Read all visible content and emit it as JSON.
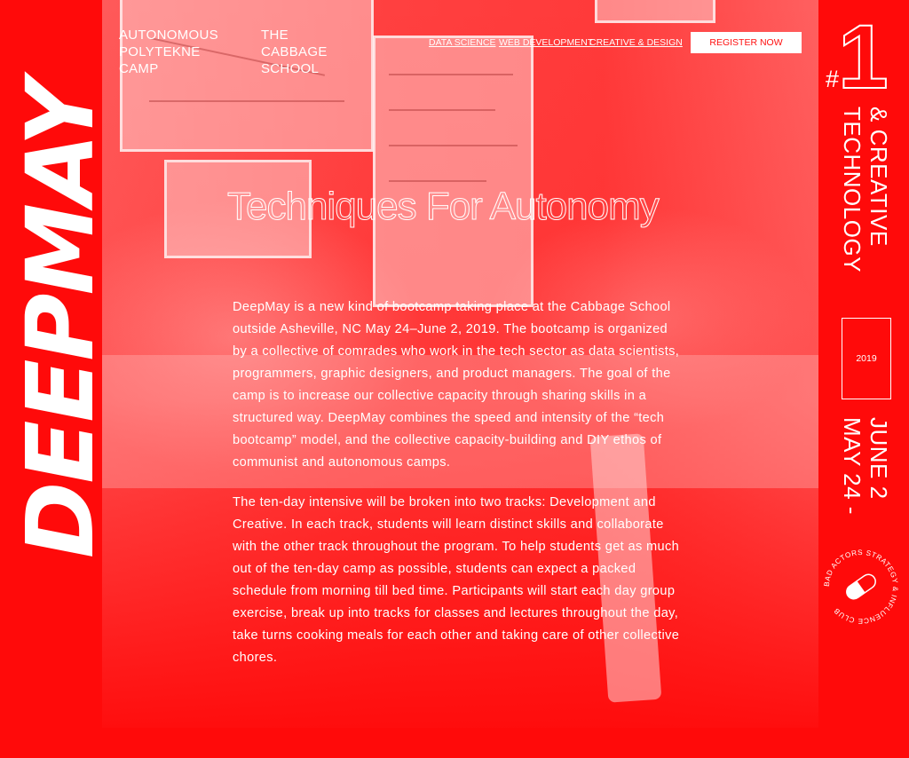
{
  "logo": {
    "text": "DEEPMAY"
  },
  "brand": {
    "left": [
      "AUTONOMOUS",
      "POLYTEKNE",
      "CAMP"
    ],
    "right": [
      "THE",
      "CABBAGE",
      "SCHOOL"
    ]
  },
  "nav": {
    "items": [
      "DATA SCIENCE",
      "WEB DEVELOPMENT",
      "CREATIVE & DESIGN"
    ],
    "register": "REGISTER NOW"
  },
  "main": {
    "title": "Techniques For Autonomy",
    "paragraphs": [
      "DeepMay is a new kind of bootcamp taking place at the Cabbage School outside Asheville, NC May 24–June 2, 2019. The bootcamp is organized by a collective of comrades who work in the tech sector as data scientists, programmers, graphic designers, and product managers. The goal of the camp is to increase our collective capacity through sharing skills in a structured way. DeepMay combines the speed and intensity of the “tech bootcamp” model, and the collective capacity-building and DIY ethos of communist and autonomous camps.",
      "The ten-day intensive will be broken into two tracks: Development and Creative. In each track, students will learn distinct skills and collaborate with the other track throughout the program. To help students get as much out of the ten-day camp as possible, students can expect a packed schedule from morning till bed time. Participants will start each day group exercise, break up into tracks for classes and lectures throughout the day, take turns cooking meals for each other and taking care of other collective chores."
    ]
  },
  "sidebar": {
    "hash": "#",
    "number": "1",
    "tagline_line1": "TECHNOLOGY",
    "tagline_line2": "& CREATIVE",
    "year": "2019",
    "dates_line1": "MAY 24 -",
    "dates_line2": "JUNE 2",
    "badge_text": "BAD ACTORS STRATEGY & INFLUENCE CLUB"
  },
  "colors": {
    "background": "#ff0a0a",
    "text": "#ffffff",
    "button_text": "#ff1010"
  }
}
